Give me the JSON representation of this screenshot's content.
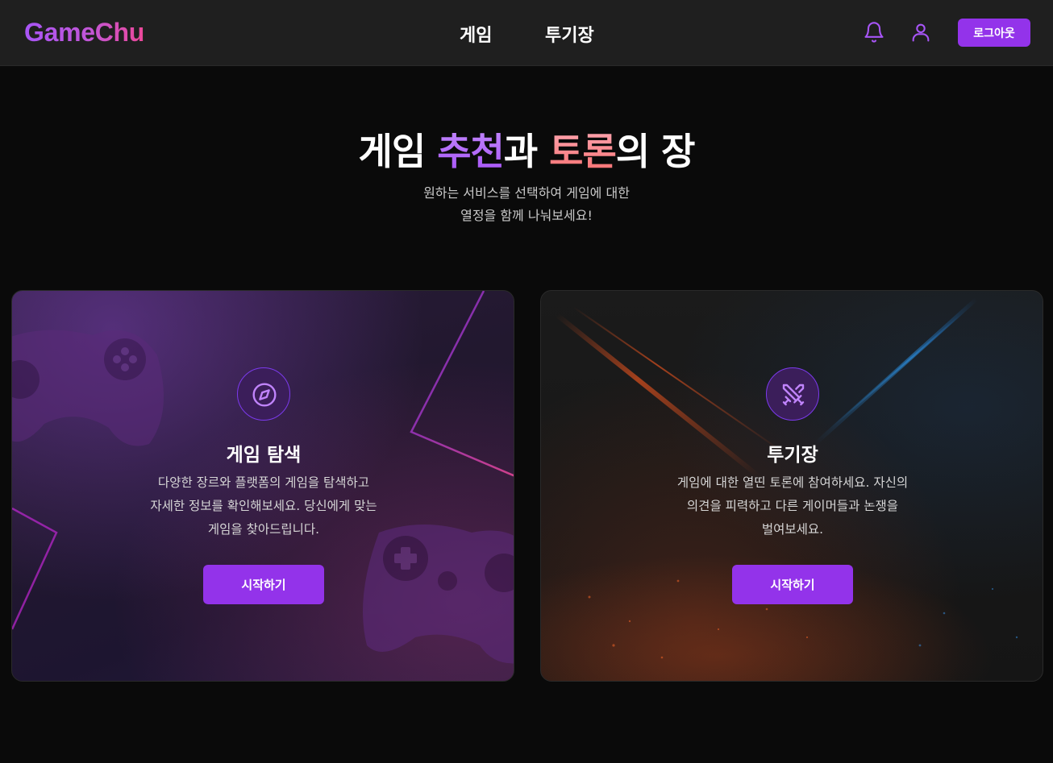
{
  "header": {
    "logo": "GameChu",
    "nav": [
      {
        "label": "게임"
      },
      {
        "label": "투기장"
      }
    ],
    "icons": [
      "bell-icon",
      "user-icon"
    ],
    "logout_label": "로그아웃"
  },
  "hero": {
    "title_part1": "게임 ",
    "title_highlight1": "추천",
    "title_part2": "과 ",
    "title_highlight2": "토론",
    "title_part3": "의 장",
    "subtitle_line1": "원하는 서비스를 선택하여 게임에 대한",
    "subtitle_line2": "열정을 함께 나눠보세요!"
  },
  "cards": [
    {
      "icon": "compass-icon",
      "title": "게임 탐색",
      "desc_line1": "다양한 장르와 플랫폼의 게임을 탐색하고",
      "desc_line2": "자세한 정보를 확인해보세요. 당신에게 맞는",
      "desc_line3": "게임을 찾아드립니다.",
      "button": "시작하기"
    },
    {
      "icon": "crossed-swords-icon",
      "title": "투기장",
      "desc_line1": "게임에 대한 열띤 토론에 참여하세요. 자신의",
      "desc_line2": "의견을 피력하고 다른 게이머들과 논쟁을",
      "desc_line3": "벌여보세요.",
      "button": "시작하기"
    }
  ],
  "colors": {
    "accent": "#9333ea",
    "header_bg": "#1f1f1f",
    "page_bg": "#0a0a0a",
    "highlight_purple": "#a855f7",
    "highlight_red": "#f87171"
  }
}
